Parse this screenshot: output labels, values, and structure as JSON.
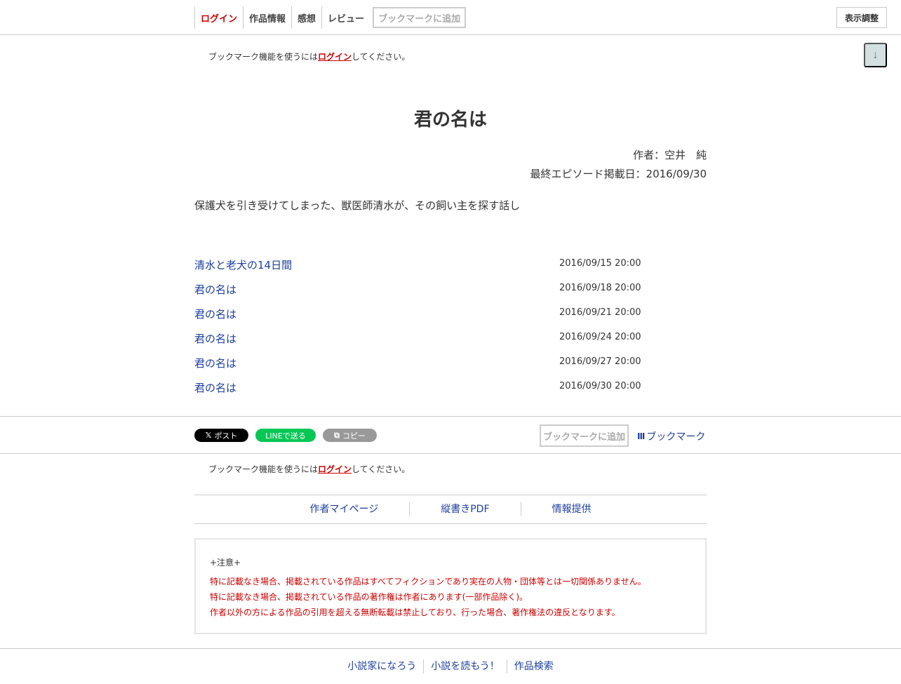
{
  "nav": {
    "login": "ログイン",
    "info": "作品情報",
    "impressions": "感想",
    "review": "レビュー",
    "bookmark_add": "ブックマークに追加",
    "display_settings": "表示調整"
  },
  "login_note": {
    "before": "ブックマーク機能を使うには",
    "link": "ログイン",
    "after": "してください。"
  },
  "scroll_down_icon": "↓",
  "work": {
    "title": "君の名は",
    "author": "作者：空井　純",
    "last_episode_date": "最終エピソード掲載日：2016/09/30",
    "synopsis": "保護犬を引き受けてしまった、獣医師清水が、その飼い主を探す話し"
  },
  "episodes": [
    {
      "title": "清水と老犬の14日間",
      "date": "2016/09/15 20:00"
    },
    {
      "title": "君の名は",
      "date": "2016/09/18 20:00"
    },
    {
      "title": "君の名は",
      "date": "2016/09/21 20:00"
    },
    {
      "title": "君の名は",
      "date": "2016/09/24 20:00"
    },
    {
      "title": "君の名は",
      "date": "2016/09/27 20:00"
    },
    {
      "title": "君の名は",
      "date": "2016/09/30 20:00"
    }
  ],
  "share": {
    "x_glyph": "𝕏",
    "x_post": "ポスト",
    "line_send": "LINEで送る",
    "copy_glyph": "⧉",
    "copy": "コピー",
    "bookmark_add": "ブックマークに追加",
    "bookmark_glyph": "III",
    "bookmark": "ブックマーク"
  },
  "links": {
    "author_page": "作者マイページ",
    "vertical_pdf": "縦書きPDF",
    "report": "情報提供"
  },
  "notice": {
    "heading": "+注意+",
    "lines": [
      "特に記載なき場合、掲載されている作品はすべてフィクションであり実在の人物・団体等とは一切関係ありません。",
      "特に記載なき場合、掲載されている作品の著作権は作者にあります(一部作品除く)。",
      "作者以外の方による作品の引用を超える無断転載は禁止しており、行った場合、著作権法の違反となります。"
    ]
  },
  "footer": {
    "link1": "小説家になろう",
    "link2": "小説を読もう！",
    "link3": "作品検索"
  },
  "colors": {
    "accent_red": "#cc0000",
    "link_blue": "#1c3f9e",
    "line_green": "#06c755"
  }
}
